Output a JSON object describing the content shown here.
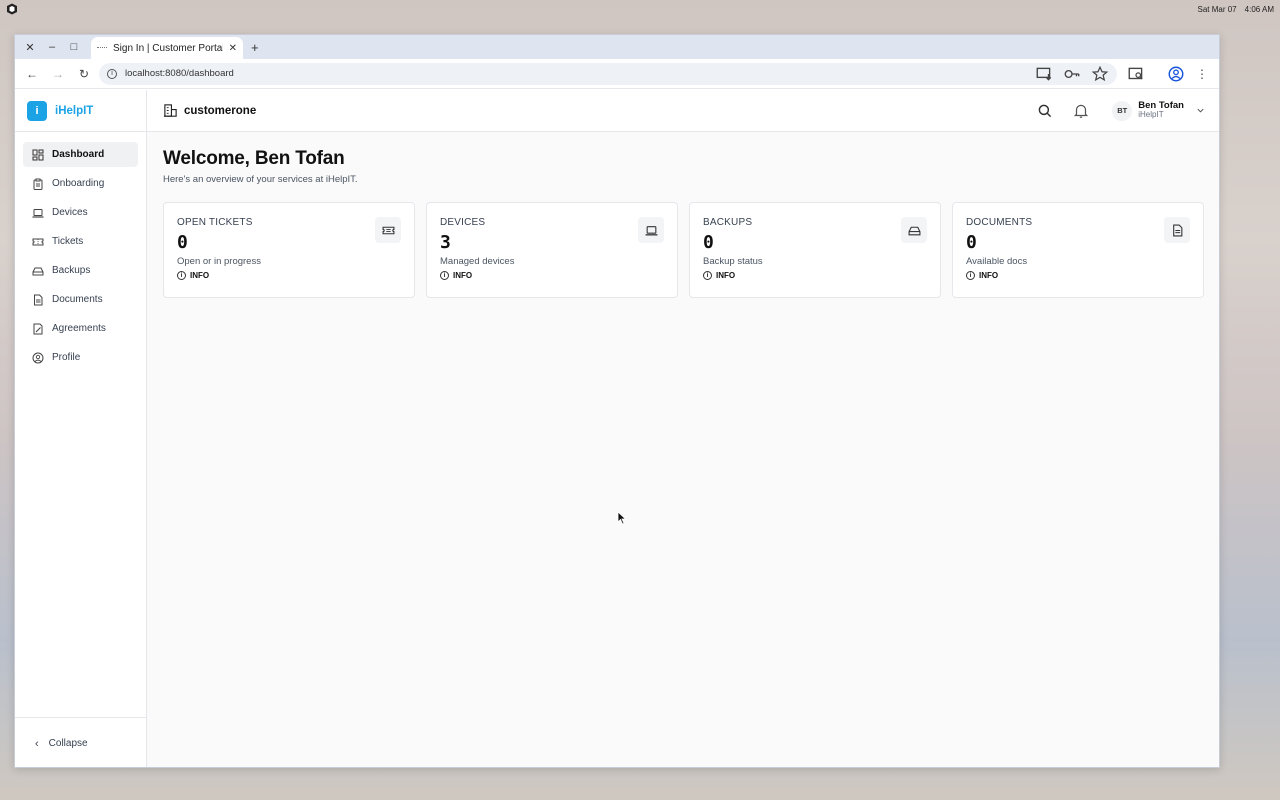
{
  "desktop": {
    "date": "Sat Mar 07",
    "time": "4:06 AM"
  },
  "browser": {
    "tab_title": "Sign In | Customer Portal",
    "url": "localhost:8080/dashboard"
  },
  "brand": {
    "logo_letter": "i",
    "name": "iHelpIT"
  },
  "sidebar": {
    "items": [
      {
        "label": "Dashboard",
        "icon": "dashboard-icon",
        "active": true
      },
      {
        "label": "Onboarding",
        "icon": "clipboard-icon"
      },
      {
        "label": "Devices",
        "icon": "laptop-icon"
      },
      {
        "label": "Tickets",
        "icon": "ticket-icon"
      },
      {
        "label": "Backups",
        "icon": "hard-drive-icon"
      },
      {
        "label": "Documents",
        "icon": "document-icon"
      },
      {
        "label": "Agreements",
        "icon": "agreement-icon"
      },
      {
        "label": "Profile",
        "icon": "user-circle-icon"
      }
    ],
    "collapse_label": "Collapse"
  },
  "header": {
    "org_name": "customerone",
    "user": {
      "initials": "BT",
      "name": "Ben Tofan",
      "org": "iHelpIT"
    }
  },
  "main": {
    "title": "Welcome, Ben Tofan",
    "subtitle": "Here's an overview of your services at iHelpIT.",
    "cards": [
      {
        "label": "OPEN TICKETS",
        "value": "0",
        "desc": "Open or in progress",
        "tag": "INFO",
        "icon": "ticket-icon"
      },
      {
        "label": "DEVICES",
        "value": "3",
        "desc": "Managed devices",
        "tag": "INFO",
        "icon": "laptop-icon"
      },
      {
        "label": "BACKUPS",
        "value": "0",
        "desc": "Backup status",
        "tag": "INFO",
        "icon": "hard-drive-icon"
      },
      {
        "label": "DOCUMENTS",
        "value": "0",
        "desc": "Available docs",
        "tag": "INFO",
        "icon": "document-icon"
      }
    ]
  }
}
